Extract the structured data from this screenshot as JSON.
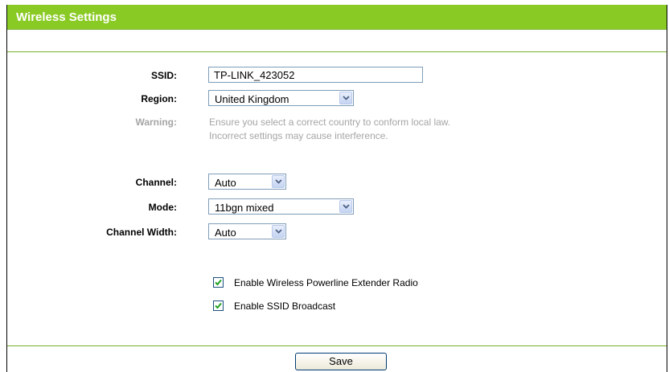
{
  "header": {
    "title": "Wireless Settings"
  },
  "form": {
    "ssid": {
      "label": "SSID:",
      "value": "TP-LINK_423052"
    },
    "region": {
      "label": "Region:",
      "value": "United Kingdom"
    },
    "warning": {
      "label": "Warning:",
      "line1": "Ensure you select a correct country to conform local law.",
      "line2": "Incorrect settings may cause interference."
    },
    "channel": {
      "label": "Channel:",
      "value": "Auto"
    },
    "mode": {
      "label": "Mode:",
      "value": "11bgn mixed"
    },
    "channel_width": {
      "label": "Channel Width:",
      "value": "Auto"
    },
    "enable_powerline": {
      "label": "Enable Wireless Powerline Extender Radio",
      "checked": true
    },
    "enable_ssid_broadcast": {
      "label": "Enable SSID Broadcast",
      "checked": true
    }
  },
  "footer": {
    "save_label": "Save"
  },
  "colors": {
    "header_bg": "#8aca24",
    "rule": "#77b02a",
    "muted_text": "#a5a5a5",
    "input_border": "#7f9db9"
  }
}
